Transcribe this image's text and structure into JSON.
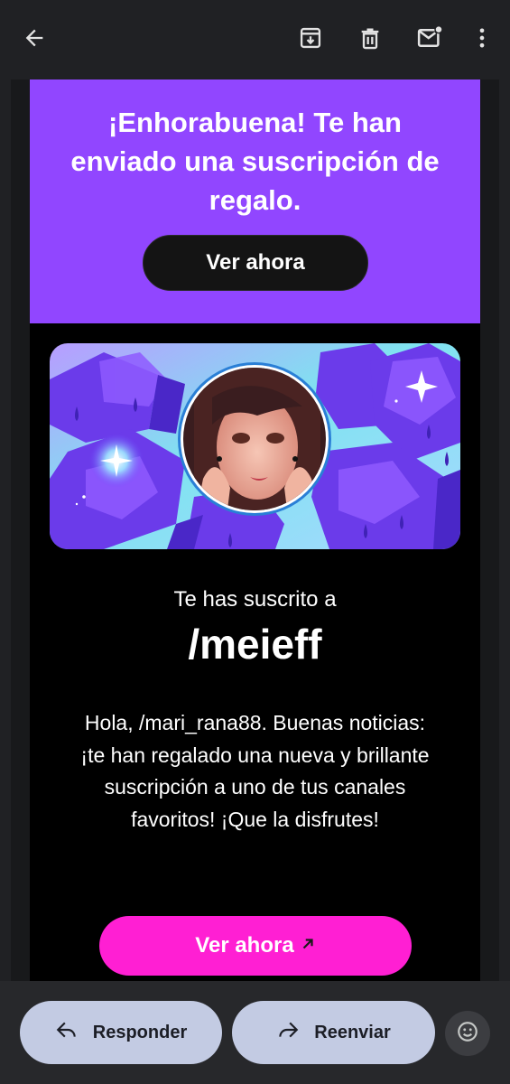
{
  "toolbar": {
    "icons": [
      "back-arrow-icon",
      "archive-icon",
      "trash-icon",
      "mark-unread-icon",
      "more-vert-icon"
    ]
  },
  "email": {
    "headline": "¡Enhorabuena! Te han enviado una suscripción de regalo.",
    "top_button": "Ver ahora",
    "subtitle": "Te has suscrito a",
    "channel": "/meieff",
    "body": "Hola, /mari_rana88. Buenas noticias: ¡te han regalado una nueva y brillante suscripción a uno de tus canales favoritos! ¡Que la disfrutes!",
    "bottom_button": "Ver ahora",
    "colors": {
      "purple": "#9146ff",
      "pink": "#ff1fd3"
    }
  },
  "actions": {
    "reply": "Responder",
    "forward": "Reenviar"
  }
}
